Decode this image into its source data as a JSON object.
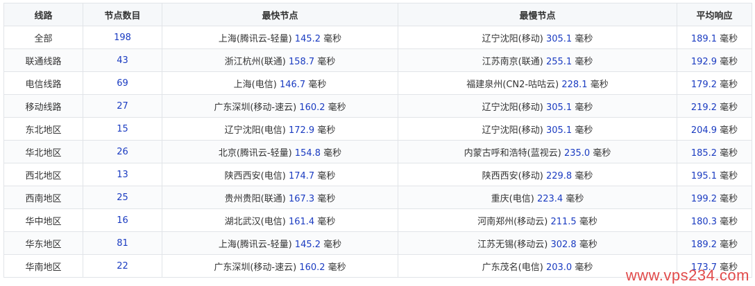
{
  "table": {
    "headers": [
      "线路",
      "节点数目",
      "最快节点",
      "最慢节点",
      "平均响应"
    ],
    "rows": [
      {
        "line": "全部",
        "count": "198",
        "fast_node": "上海(腾讯云-轻量)",
        "fast_ms": "145.2",
        "slow_node": "辽宁沈阳(移动)",
        "slow_ms": "305.1",
        "avg": "189.1"
      },
      {
        "line": "联通线路",
        "count": "43",
        "fast_node": "浙江杭州(联通)",
        "fast_ms": "158.7",
        "slow_node": "江苏南京(联通)",
        "slow_ms": "255.1",
        "avg": "192.9"
      },
      {
        "line": "电信线路",
        "count": "69",
        "fast_node": "上海(电信)",
        "fast_ms": "146.7",
        "slow_node": "福建泉州(CN2-咕咕云)",
        "slow_ms": "228.1",
        "avg": "179.2"
      },
      {
        "line": "移动线路",
        "count": "27",
        "fast_node": "广东深圳(移动-速云)",
        "fast_ms": "160.2",
        "slow_node": "辽宁沈阳(移动)",
        "slow_ms": "305.1",
        "avg": "219.2"
      },
      {
        "line": "东北地区",
        "count": "15",
        "fast_node": "辽宁沈阳(电信)",
        "fast_ms": "172.9",
        "slow_node": "辽宁沈阳(移动)",
        "slow_ms": "305.1",
        "avg": "204.9"
      },
      {
        "line": "华北地区",
        "count": "26",
        "fast_node": "北京(腾讯云-轻量)",
        "fast_ms": "154.8",
        "slow_node": "内蒙古呼和浩特(蓝视云)",
        "slow_ms": "235.0",
        "avg": "185.2"
      },
      {
        "line": "西北地区",
        "count": "13",
        "fast_node": "陕西西安(电信)",
        "fast_ms": "174.7",
        "slow_node": "陕西西安(移动)",
        "slow_ms": "229.8",
        "avg": "195.1"
      },
      {
        "line": "西南地区",
        "count": "25",
        "fast_node": "贵州贵阳(联通)",
        "fast_ms": "167.3",
        "slow_node": "重庆(电信)",
        "slow_ms": "223.4",
        "avg": "199.2"
      },
      {
        "line": "华中地区",
        "count": "16",
        "fast_node": "湖北武汉(电信)",
        "fast_ms": "161.4",
        "slow_node": "河南郑州(移动云)",
        "slow_ms": "211.5",
        "avg": "180.3"
      },
      {
        "line": "华东地区",
        "count": "81",
        "fast_node": "上海(腾讯云-轻量)",
        "fast_ms": "145.2",
        "slow_node": "江苏无锡(移动云)",
        "slow_ms": "302.8",
        "avg": "189.2"
      },
      {
        "line": "华南地区",
        "count": "22",
        "fast_node": "广东深圳(移动-速云)",
        "fast_ms": "160.2",
        "slow_node": "广东茂名(电信)",
        "slow_ms": "203.0",
        "avg": "173.7"
      }
    ]
  },
  "unit": "毫秒",
  "watermark": "www.vps234.com",
  "colors": {
    "number": "#1a3bc1",
    "border": "#e1e4e8",
    "header_bg": "#f6f8fa",
    "watermark": "#e14b4b"
  }
}
